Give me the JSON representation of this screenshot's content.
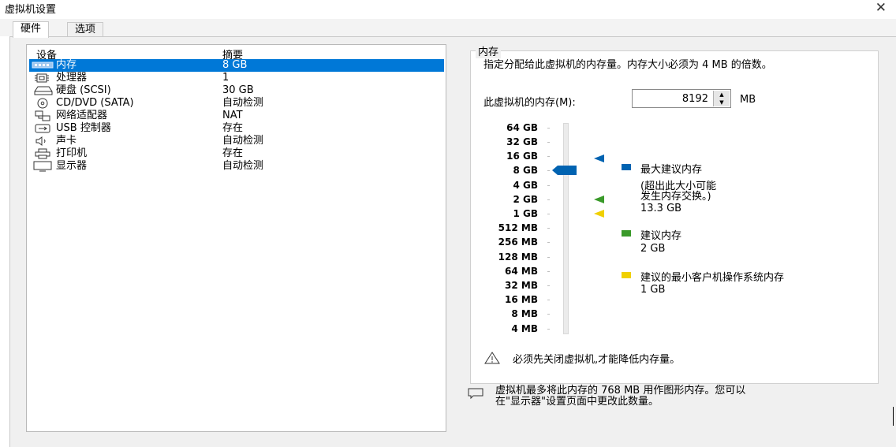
{
  "window": {
    "title": "虚拟机设置"
  },
  "tabs": [
    {
      "label": "硬件"
    },
    {
      "label": "选项"
    }
  ],
  "device_list": {
    "headers": {
      "device": "设备",
      "summary": "摘要"
    },
    "rows": [
      {
        "name": "内存",
        "summary": "8 GB",
        "icon": "memory-icon",
        "selected": true
      },
      {
        "name": "处理器",
        "summary": "1",
        "icon": "processor-icon"
      },
      {
        "name": "硬盘 (SCSI)",
        "summary": "30 GB",
        "icon": "hard-disk-icon"
      },
      {
        "name": "CD/DVD (SATA)",
        "summary": "自动检测",
        "icon": "cd-dvd-icon"
      },
      {
        "name": "网络适配器",
        "summary": "NAT",
        "icon": "network-adapter-icon"
      },
      {
        "name": "USB 控制器",
        "summary": "存在",
        "icon": "usb-controller-icon"
      },
      {
        "name": "声卡",
        "summary": "自动检测",
        "icon": "sound-card-icon"
      },
      {
        "name": "打印机",
        "summary": "存在",
        "icon": "printer-icon"
      },
      {
        "name": "显示器",
        "summary": "自动检测",
        "icon": "display-icon"
      }
    ]
  },
  "memory": {
    "group_title": "内存",
    "description": "指定分配给此虚拟机的内存量。内存大小必须为 4 MB 的倍数。",
    "field_label": "此虚拟机的内存(M):",
    "value": "8192",
    "unit": "MB",
    "scale_labels": [
      "64 GB",
      "32 GB",
      "16 GB",
      "8 GB",
      "4 GB",
      "2 GB",
      "1 GB",
      "512 MB",
      "256 MB",
      "128 MB",
      "64 MB",
      "32 MB",
      "16 MB",
      "8 MB",
      "4 MB"
    ],
    "slider_position": "8 GB",
    "markers": {
      "max_recommended": "16 GB",
      "recommended": "2 GB",
      "min_guest_os": "1 GB"
    },
    "legend": {
      "max_title": "最大建议内存",
      "max_note_1": "(超出此大小可能",
      "max_note_2": "发生内存交换。)",
      "max_value": "13.3 GB",
      "rec_title": "建议内存",
      "rec_value": "2 GB",
      "min_title": "建议的最小客户机操作系统内存",
      "min_value": "1 GB"
    },
    "warning": "必须先关闭虚拟机,才能降低内存量。",
    "info_line_1": "虚拟机最多将此内存的 768 MB 用作图形内存。您可以",
    "info_line_2": "在\"显示器\"设置页面中更改此数量。"
  },
  "colors": {
    "selection": "#0078d7",
    "max": "#0063b1",
    "recommended": "#3a9a2a",
    "minimum": "#f0d000"
  }
}
